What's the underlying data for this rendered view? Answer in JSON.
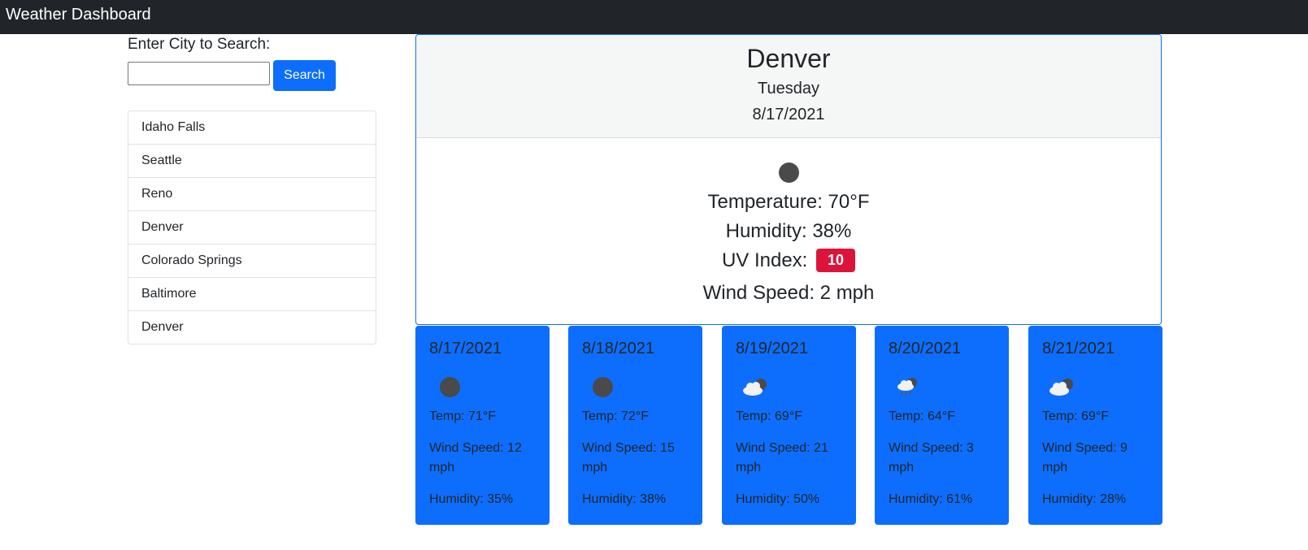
{
  "app": {
    "title": "Weather Dashboard"
  },
  "search": {
    "label": "Enter City to Search:",
    "input_value": "",
    "button_label": "Search"
  },
  "history": [
    {
      "label": "Idaho Falls"
    },
    {
      "label": "Seattle"
    },
    {
      "label": "Reno"
    },
    {
      "label": "Denver"
    },
    {
      "label": "Colorado Springs"
    },
    {
      "label": "Baltimore"
    },
    {
      "label": "Denver"
    }
  ],
  "current": {
    "city": "Denver",
    "day": "Tuesday",
    "date": "8/17/2021",
    "icon": "night-clear-icon",
    "temperature": "Temperature: 70°F",
    "humidity": "Humidity: 38%",
    "uv_label": "UV Index:",
    "uv_value": "10",
    "uv_color": "#dc143c",
    "wind": "Wind Speed: 2 mph"
  },
  "forecast": [
    {
      "date": "8/17/2021",
      "icon": "night-clear-icon",
      "temp": "Temp: 71°F",
      "wind": "Wind Speed: 12 mph",
      "humidity": "Humidity: 35%"
    },
    {
      "date": "8/18/2021",
      "icon": "night-clear-icon",
      "temp": "Temp: 72°F",
      "wind": "Wind Speed: 15 mph",
      "humidity": "Humidity: 38%"
    },
    {
      "date": "8/19/2021",
      "icon": "night-cloudy-icon",
      "temp": "Temp: 69°F",
      "wind": "Wind Speed: 21 mph",
      "humidity": "Humidity: 50%"
    },
    {
      "date": "8/20/2021",
      "icon": "night-rain-icon",
      "temp": "Temp: 64°F",
      "wind": "Wind Speed: 3 mph",
      "humidity": "Humidity: 61%"
    },
    {
      "date": "8/21/2021",
      "icon": "night-cloudy-icon",
      "temp": "Temp: 69°F",
      "wind": "Wind Speed: 9 mph",
      "humidity": "Humidity: 28%"
    }
  ],
  "colors": {
    "navbar": "#212529",
    "accent": "#0d6efd",
    "uv_high": "#dc143c"
  }
}
